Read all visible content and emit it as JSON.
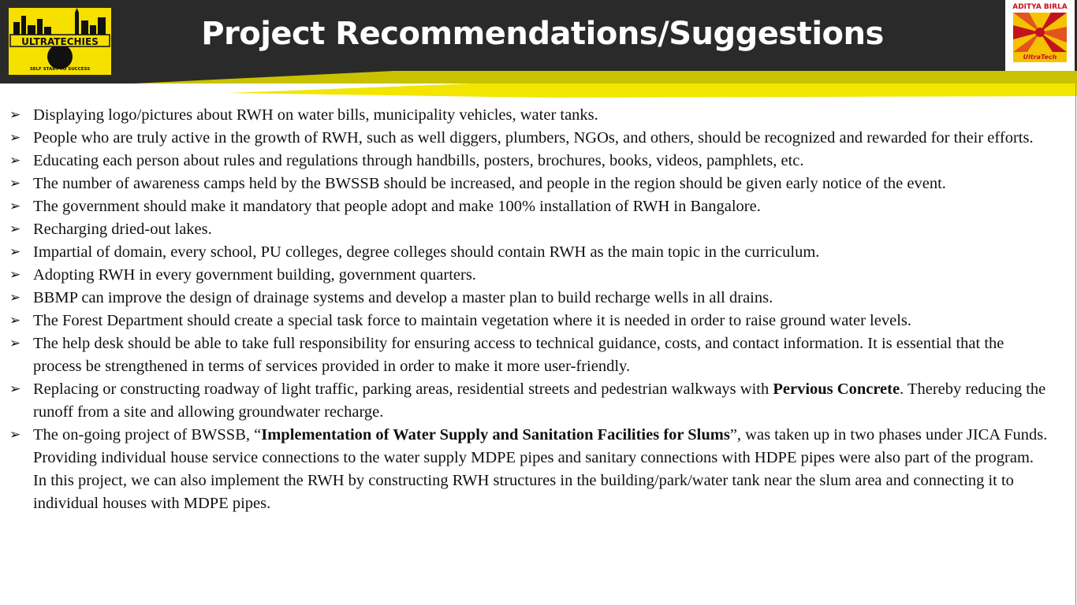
{
  "header": {
    "title": "Project Recommendations/Suggestions",
    "colors": {
      "bar": "#2a2a2a",
      "accent_yellow": "#f2e600",
      "accent_olive": "#c9c200"
    }
  },
  "logo_left": {
    "name": "ULTRATECHIES",
    "tagline": "SELF START TO SUCCESS"
  },
  "logo_right": {
    "brand": "ADITYA BIRLA",
    "sub": "UltraTech"
  },
  "bullet_icon": "arrow-bullet-icon",
  "items": [
    {
      "parts": [
        {
          "t": "Displaying logo/pictures about RWH on water bills, municipality vehicles, water tanks."
        }
      ]
    },
    {
      "parts": [
        {
          "t": "People who are truly active in the growth of RWH, such as well diggers, plumbers, NGOs, and others, should be recognized and rewarded for their efforts."
        }
      ]
    },
    {
      "parts": [
        {
          "t": "Educating each person about rules and regulations through handbills, posters, brochures, books, videos, pamphlets, etc."
        }
      ]
    },
    {
      "parts": [
        {
          "t": "The number of awareness camps held by the BWSSB should be increased, and people in the region should be given early notice of the event."
        }
      ]
    },
    {
      "parts": [
        {
          "t": "The government should make it mandatory that people adopt and make 100% installation of RWH in Bangalore."
        }
      ]
    },
    {
      "parts": [
        {
          "t": "Recharging dried-out lakes."
        }
      ]
    },
    {
      "parts": [
        {
          "t": "Impartial of  domain, every school, PU colleges, degree colleges should contain RWH as the main topic in the curriculum."
        }
      ]
    },
    {
      "parts": [
        {
          "t": "Adopting RWH in every government building, government quarters."
        }
      ]
    },
    {
      "parts": [
        {
          "t": "BBMP can improve the design of drainage systems and develop a master plan to build recharge wells in all drains."
        }
      ]
    },
    {
      "parts": [
        {
          "t": "The Forest Department should create a special task force to maintain vegetation where it is needed in order to raise ground water levels."
        }
      ]
    },
    {
      "parts": [
        {
          "t": "The help desk should be able to take full responsibility  for ensuring access to technical guidance, costs, and contact information. It is essential that the process be strengthened in terms of services provided in order to make it more user-friendly."
        }
      ]
    },
    {
      "parts": [
        {
          "t": "Replacing or constructing roadway of light traffic, parking areas, residential streets and pedestrian walkways with "
        },
        {
          "t": "Pervious Concrete",
          "bold": true
        },
        {
          "t": ". Thereby reducing the runoff from a site and allowing groundwater recharge."
        }
      ]
    },
    {
      "parts": [
        {
          "t": "The on-going project of BWSSB, “"
        },
        {
          "t": "Implementation of Water Supply and Sanitation Facilities for Slums",
          "bold": true
        },
        {
          "t": "”, was taken up in two phases under JICA Funds. Providing individual house service connections to the water supply MDPE pipes and sanitary connections with HDPE pipes were also part of the program. In this project, we can also implement the RWH by constructing RWH structures in the building/park/water tank near the slum area and connecting it to individual houses with MDPE pipes."
        }
      ]
    }
  ]
}
